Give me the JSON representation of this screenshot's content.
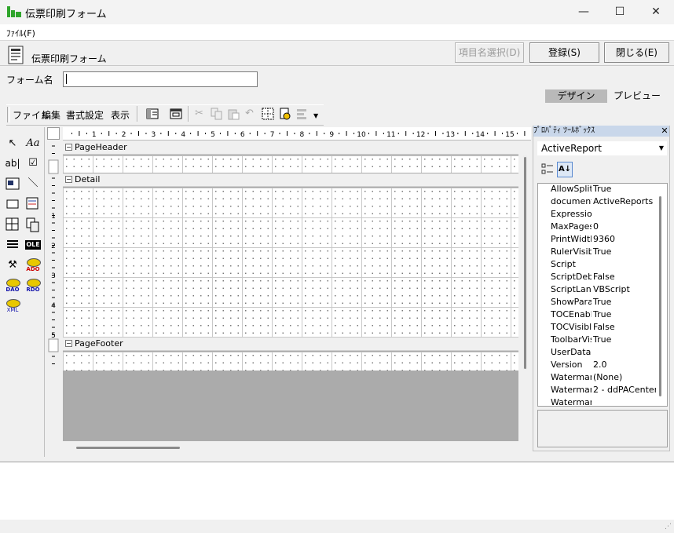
{
  "window": {
    "title": "伝票印刷フォーム",
    "minimize": "—",
    "maximize": "☐",
    "close": "✕"
  },
  "menu": {
    "file": "ﾌｧｲﾙ(F)"
  },
  "header": {
    "form_title": "伝票印刷フォーム",
    "item_select_label": "項目名選択(D)",
    "register_label": "登録(S)",
    "close_label": "閉じる(E)"
  },
  "form_name": {
    "label": "フォーム名",
    "value": ""
  },
  "tabs": {
    "design": "デザイン",
    "preview": "プレビュー"
  },
  "toolbar_menu": {
    "file": "ファイル",
    "edit": "編集",
    "format": "書式設定",
    "view": "表示"
  },
  "ruler": {
    "numbers": [
      "1",
      "2",
      "3",
      "4",
      "5",
      "6",
      "7",
      "8",
      "9",
      "10",
      "11",
      "12",
      "13",
      "14",
      "15"
    ]
  },
  "vruler": {
    "numbers": [
      "1",
      "2",
      "3",
      "4",
      "5"
    ]
  },
  "bands": {
    "page_header": "PageHeader",
    "detail": "Detail",
    "page_footer": "PageFooter"
  },
  "palette": {
    "ole": "OLE",
    "ado": "ADO",
    "dao": "DAO",
    "rdo": "RDO",
    "xml": "XML"
  },
  "properties": {
    "title": "ﾌﾟﾛﾊﾟﾃｨ ﾂｰﾙﾎﾞｯｸｽ",
    "object": "ActiveReport",
    "rows": [
      {
        "name": "AllowSplitters",
        "value": "True"
      },
      {
        "name": "documentName",
        "value": "ActiveReports"
      },
      {
        "name": "Expression",
        "value": ""
      },
      {
        "name": "MaxPages",
        "value": "0"
      },
      {
        "name": "PrintWidth",
        "value": "9360"
      },
      {
        "name": "RulerVisible",
        "value": "True"
      },
      {
        "name": "Script",
        "value": ""
      },
      {
        "name": "ScriptDebuggerEnabled",
        "value": "False"
      },
      {
        "name": "ScriptLanguage",
        "value": "VBScript"
      },
      {
        "name": "ShowParameterUI",
        "value": "True"
      },
      {
        "name": "TOCEnabled",
        "value": "True"
      },
      {
        "name": "TOCVisible",
        "value": "False"
      },
      {
        "name": "ToolbarVisible",
        "value": "True"
      },
      {
        "name": "UserData",
        "value": ""
      },
      {
        "name": "Version",
        "value": "2.0"
      },
      {
        "name": "Watermark",
        "value": "(None)"
      },
      {
        "name": "WatermarkAlignment",
        "value": "2 - ddPACenter"
      },
      {
        "name": "Watermark",
        "value": ""
      }
    ]
  }
}
